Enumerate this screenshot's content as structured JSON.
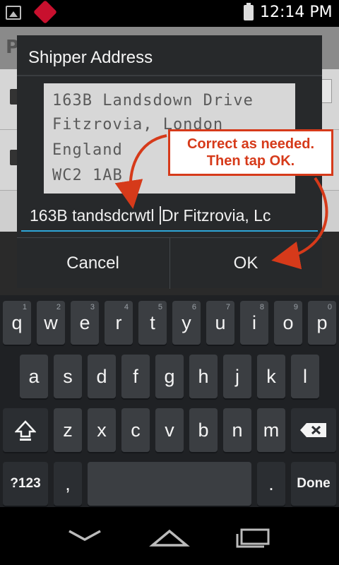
{
  "status_bar": {
    "time": "12:14 PM",
    "icons": [
      "image-icon",
      "app-notification-icon",
      "battery-icon"
    ]
  },
  "background_app": {
    "header_initial": "P"
  },
  "dialog": {
    "title": "Shipper Address",
    "scan_lines": [
      "163B Landsdown Drive",
      "Fitzrovia, London",
      "England",
      "WC2 1AB"
    ],
    "input": {
      "before_cursor": "163B tandsdcrwtl ",
      "after_cursor": "Dr Fitzrovia, Lc"
    },
    "cancel_label": "Cancel",
    "ok_label": "OK"
  },
  "callout": {
    "line1": "Correct as needed.",
    "line2": "Then tap OK.",
    "color": "#d63a1a"
  },
  "keyboard": {
    "row1": [
      "q",
      "w",
      "e",
      "r",
      "t",
      "y",
      "u",
      "i",
      "o",
      "p"
    ],
    "row1_hints": [
      "1",
      "2",
      "3",
      "4",
      "5",
      "6",
      "7",
      "8",
      "9",
      "0"
    ],
    "row2": [
      "a",
      "s",
      "d",
      "f",
      "g",
      "h",
      "j",
      "k",
      "l"
    ],
    "row3": [
      "z",
      "x",
      "c",
      "v",
      "b",
      "n",
      "m"
    ],
    "symbols_label": "?123",
    "comma": ",",
    "period": ".",
    "done_label": "Done",
    "shift_icon": "shift-icon",
    "backspace_icon": "backspace-icon"
  },
  "navbar": {
    "icons": [
      "back-chevron-icon",
      "home-icon",
      "recent-apps-icon"
    ]
  },
  "colors": {
    "accent_blue": "#2ea6d8",
    "dialog_bg": "#27292b",
    "key_bg": "#3b3e42"
  }
}
